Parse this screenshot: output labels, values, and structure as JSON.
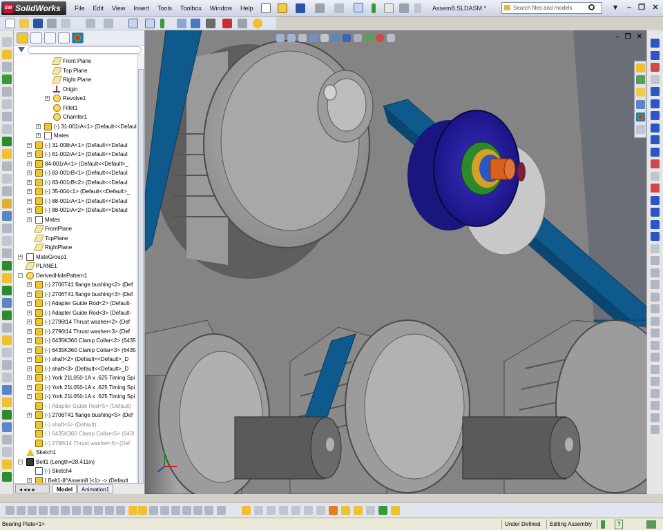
{
  "app": {
    "name": "SolidWorks",
    "document_title": "Assem8.SLDASM *"
  },
  "menu": [
    "File",
    "Edit",
    "View",
    "Insert",
    "Tools",
    "Toolbox",
    "Window",
    "Help"
  ],
  "search": {
    "placeholder": "Search files and models"
  },
  "tree": {
    "rows": [
      {
        "label": "Front Plane",
        "indent": 3,
        "icon": "plane",
        "expander": ""
      },
      {
        "label": "Top Plane",
        "indent": 3,
        "icon": "plane",
        "expander": ""
      },
      {
        "label": "Right Plane",
        "indent": 3,
        "icon": "plane",
        "expander": ""
      },
      {
        "label": "Origin",
        "indent": 3,
        "icon": "origin",
        "expander": ""
      },
      {
        "label": "Revolve1",
        "indent": 3,
        "icon": "feature",
        "expander": "+"
      },
      {
        "label": "Fillet1",
        "indent": 3,
        "icon": "feature",
        "expander": ""
      },
      {
        "label": "Chamfer1",
        "indent": 3,
        "icon": "feature",
        "expander": ""
      },
      {
        "label": "(-) 31-001rA<1> (Default<<Defaul",
        "indent": 2,
        "icon": "part",
        "expander": "+"
      },
      {
        "label": "Mates",
        "indent": 2,
        "icon": "mates",
        "expander": "+"
      },
      {
        "label": "(-) 31-008rA<1> (Default<<Defaul",
        "indent": 1,
        "icon": "part",
        "expander": "+"
      },
      {
        "label": "(-) 81-002rA<1> (Default<<Defaul",
        "indent": 1,
        "icon": "part",
        "expander": "+"
      },
      {
        "label": "84-001rA<1> (Default<<Default>_",
        "indent": 1,
        "icon": "part",
        "expander": "+"
      },
      {
        "label": "(-) 83-001rB<1> (Default<<Defaul",
        "indent": 1,
        "icon": "part",
        "expander": "+"
      },
      {
        "label": "(-) 83-001rB<2> (Default<<Defaul",
        "indent": 1,
        "icon": "part",
        "expander": "+"
      },
      {
        "label": "(-) 35-004<1> (Default<<Default>_",
        "indent": 1,
        "icon": "part",
        "expander": "+"
      },
      {
        "label": "(-) 88-001rA<1> (Default<<Defaul",
        "indent": 1,
        "icon": "part",
        "expander": "+"
      },
      {
        "label": "(-) 88-001rA<2> (Default<<Defaul",
        "indent": 1,
        "icon": "part",
        "expander": "+"
      },
      {
        "label": "Mates",
        "indent": 1,
        "icon": "mates",
        "expander": "+"
      },
      {
        "label": "FrontPlane",
        "indent": 1,
        "icon": "plane",
        "expander": ""
      },
      {
        "label": "TopPlane",
        "indent": 1,
        "icon": "plane",
        "expander": ""
      },
      {
        "label": "RightPlane",
        "indent": 1,
        "icon": "plane",
        "expander": ""
      },
      {
        "label": "MateGroup1",
        "indent": 0,
        "icon": "mates",
        "expander": "+"
      },
      {
        "label": "PLANE1",
        "indent": 0,
        "icon": "plane",
        "expander": ""
      },
      {
        "label": "DerivedHolePattern1",
        "indent": 0,
        "icon": "feature",
        "expander": "-"
      },
      {
        "label": "(-) 2706T41 flange bushing<2> (Def",
        "indent": 1,
        "icon": "part",
        "expander": "+"
      },
      {
        "label": "(-) 2706T41 flange bushing<3> (Def",
        "indent": 1,
        "icon": "part",
        "expander": "+"
      },
      {
        "label": "(-) Adapter Guide Rod<2> (Default-",
        "indent": 1,
        "icon": "part",
        "expander": "+"
      },
      {
        "label": "(-) Adapter Guide Rod<3> (Default-",
        "indent": 1,
        "icon": "part",
        "expander": "+"
      },
      {
        "label": "(-) 2796t14 Thrust washer<2> (Def",
        "indent": 1,
        "icon": "part",
        "expander": "+"
      },
      {
        "label": "(-) 2796t14 Thrust washer<3> (Def",
        "indent": 1,
        "icon": "part",
        "expander": "+"
      },
      {
        "label": "(-) 6435K360 Clamp Collar<2> (6435",
        "indent": 1,
        "icon": "part",
        "expander": "+"
      },
      {
        "label": "(-) 6435K360 Clamp Collar<3> (6435",
        "indent": 1,
        "icon": "part",
        "expander": "+"
      },
      {
        "label": "(-) shaft<2> (Default<<Default>_D",
        "indent": 1,
        "icon": "part",
        "expander": "+"
      },
      {
        "label": "(-) shaft<3> (Default<<Default>_D",
        "indent": 1,
        "icon": "part",
        "expander": "+"
      },
      {
        "label": "(-) York 21L050-1A x .625 Timing Spi",
        "indent": 1,
        "icon": "part",
        "expander": "+"
      },
      {
        "label": "(-) York 21L050-1A x .625 Timing Spi",
        "indent": 1,
        "icon": "part",
        "expander": "+"
      },
      {
        "label": "(-) York 21L050-1A x .625 Timing Spi",
        "indent": 1,
        "icon": "part",
        "expander": "+"
      },
      {
        "label": "(-) Adapter Guide Rod<5> (Default)",
        "indent": 1,
        "icon": "part",
        "expander": "",
        "dim": true
      },
      {
        "label": "(-) 2706T41 flange bushing<5> (Def",
        "indent": 1,
        "icon": "part",
        "expander": "+"
      },
      {
        "label": "(-) shaft<5> (Default)",
        "indent": 1,
        "icon": "part",
        "expander": "",
        "dim": true
      },
      {
        "label": "(-) 6435K360 Clamp Collar<5> (643!",
        "indent": 1,
        "icon": "part",
        "expander": "",
        "dim": true
      },
      {
        "label": "(-) 2796t14 Thrust washer<5> (Def",
        "indent": 1,
        "icon": "part",
        "expander": "",
        "dim": true
      },
      {
        "label": "Sketch1",
        "indent": 0,
        "icon": "warn",
        "expander": ""
      },
      {
        "label": "Belt1 (Length=28.411in)",
        "indent": 0,
        "icon": "belt",
        "expander": "-"
      },
      {
        "label": "(-) Sketch4",
        "indent": 1,
        "icon": "sketch",
        "expander": ""
      },
      {
        "label": "[ Belt1-8^Assem8 ]<1> -> (Default",
        "indent": 1,
        "icon": "part",
        "expander": "+"
      }
    ]
  },
  "panel_tabs": {
    "model": "Model",
    "animation": "Animation1"
  },
  "status": {
    "selection": "Bearing Plate<1>",
    "definition": "Under Defined",
    "mode": "Editing Assembly",
    "help": "?"
  },
  "colors": {
    "belt": "#0f5a8c",
    "accent_part": "#2a1e9a",
    "background_plate": "#7c7c7c"
  }
}
